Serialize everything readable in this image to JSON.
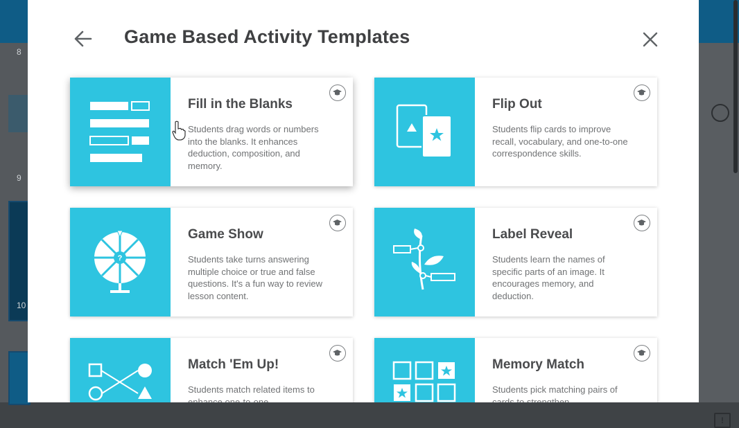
{
  "modal": {
    "title": "Game Based Activity Templates",
    "back_icon": "arrow-left-icon",
    "close_icon": "close-icon"
  },
  "templates": [
    {
      "title": "Fill in the Blanks",
      "description": "Students drag words or numbers into the blanks. It enhances deduction, composition, and memory.",
      "thumb_icon": "fill-blanks-icon",
      "badge_icon": "graduation-cap-icon"
    },
    {
      "title": "Flip Out",
      "description": "Students flip cards to improve recall, vocabulary, and one-to-one correspondence skills.",
      "thumb_icon": "flip-cards-icon",
      "badge_icon": "graduation-cap-icon"
    },
    {
      "title": "Game Show",
      "description": "Students take turns answering multiple choice or true and false questions. It's a fun way to review lesson content.",
      "thumb_icon": "prize-wheel-icon",
      "badge_icon": "graduation-cap-icon"
    },
    {
      "title": "Label Reveal",
      "description": "Students learn the names of specific parts of an image. It encourages memory, and deduction.",
      "thumb_icon": "labeled-plant-icon",
      "badge_icon": "graduation-cap-icon"
    },
    {
      "title": "Match 'Em Up!",
      "description": "Students match related items to enhance one-to-one",
      "thumb_icon": "match-shapes-icon",
      "badge_icon": "graduation-cap-icon"
    },
    {
      "title": "Memory Match",
      "description": "Students pick matching pairs of cards to strengthen",
      "thumb_icon": "memory-grid-icon",
      "badge_icon": "graduation-cap-icon"
    }
  ],
  "background": {
    "left_numbers": [
      "8",
      "9",
      "10"
    ]
  },
  "colors": {
    "accent": "#2ec4e0",
    "title": "#3f4042",
    "overlay_topbar": "#0f5c86"
  }
}
